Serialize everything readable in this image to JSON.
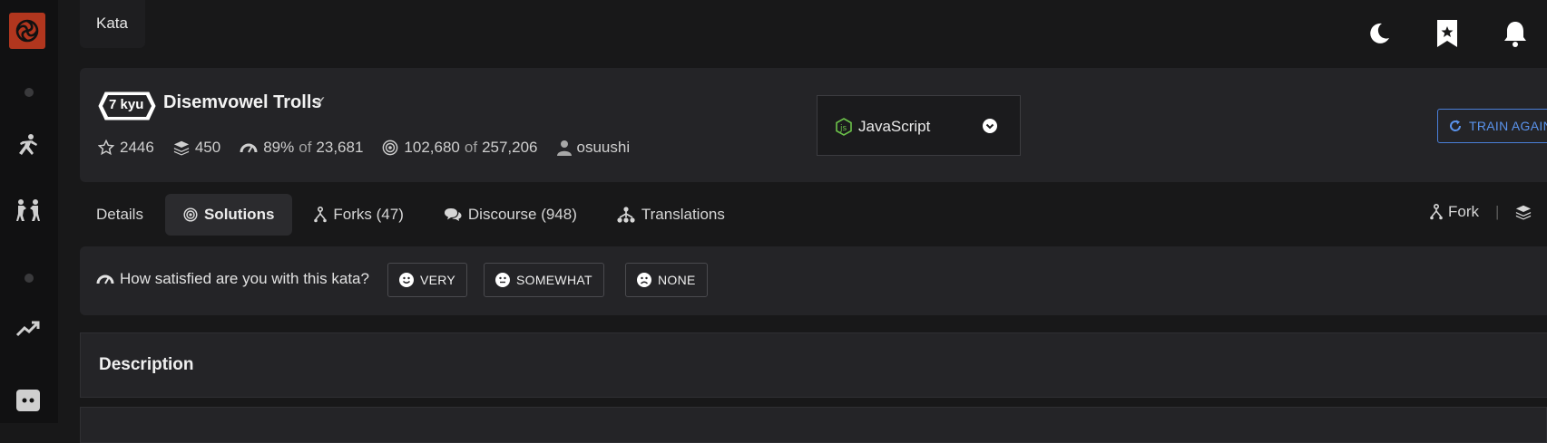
{
  "app": {
    "top_tab": "Kata"
  },
  "sidebar": {
    "icons": [
      "codewars-logo-icon",
      "training-icon",
      "kumite-icon",
      "leaderboard-trend-icon",
      "discord-icon"
    ]
  },
  "topbar": {
    "icons": [
      "moon-icon",
      "bookmark-icon",
      "bell-icon"
    ]
  },
  "kata": {
    "rank": "7 kyu",
    "title": "Disemvowel Trolls",
    "stars": "2446",
    "collections": "450",
    "satisfaction_pct": "89%",
    "satisfaction_of": "of",
    "satisfaction_votes": "23,681",
    "completed": "102,680",
    "completed_of": "of",
    "attempts": "257,206",
    "author": "osuushi"
  },
  "language": {
    "selected": "JavaScript"
  },
  "actions": {
    "train_again": "TRAIN AGAIN",
    "fork": "Fork"
  },
  "tabs": [
    {
      "label": "Details"
    },
    {
      "label": "Solutions"
    },
    {
      "label": "Forks (47)"
    },
    {
      "label": "Discourse (948)"
    },
    {
      "label": "Translations"
    }
  ],
  "satisfaction": {
    "question": "How satisfied are you with this kata?",
    "options": [
      "VERY",
      "SOMEWHAT",
      "NONE"
    ]
  },
  "description": {
    "title": "Description"
  },
  "colors": {
    "accent": "#b1361e",
    "link_blue": "#5a93ec",
    "bg": "#181819",
    "card": "#242427"
  }
}
